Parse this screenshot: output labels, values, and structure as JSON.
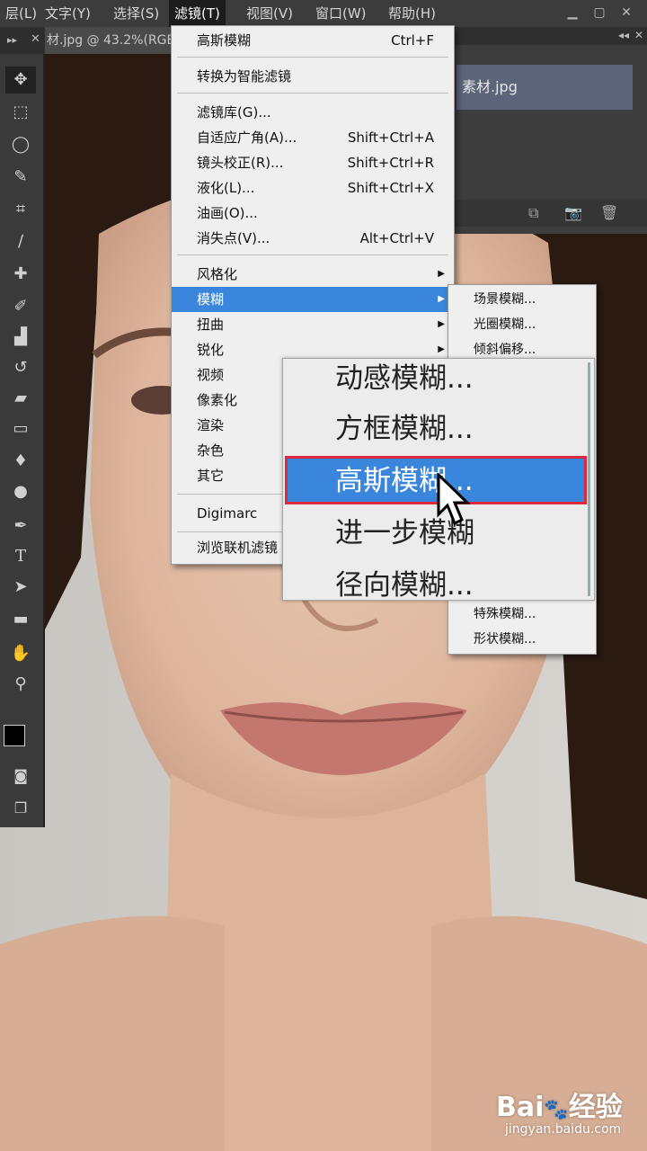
{
  "menubar": {
    "items": [
      "层(L)",
      "文字(Y)",
      "选择(S)",
      "滤镜(T)",
      "视图(V)",
      "窗口(W)",
      "帮助(H)"
    ],
    "active": "滤镜(T)"
  },
  "document_tab": {
    "title": "材.jpg @ 43.2%(RGB"
  },
  "left_strip_icons": [
    "expand-icon",
    "close-icon"
  ],
  "layers_panel": {
    "layer_name": "素材.jpg"
  },
  "filter_menu": {
    "items": [
      {
        "label": "高斯模糊",
        "shortcut": "Ctrl+F"
      },
      {
        "label": "转换为智能滤镜",
        "shortcut": ""
      },
      {
        "label": "滤镜库(G)...",
        "shortcut": ""
      },
      {
        "label": "自适应广角(A)...",
        "shortcut": "Shift+Ctrl+A"
      },
      {
        "label": "镜头校正(R)...",
        "shortcut": "Shift+Ctrl+R"
      },
      {
        "label": "液化(L)...",
        "shortcut": "Shift+Ctrl+X"
      },
      {
        "label": "油画(O)...",
        "shortcut": ""
      },
      {
        "label": "消失点(V)...",
        "shortcut": "Alt+Ctrl+V"
      },
      {
        "label": "风格化",
        "shortcut": ""
      },
      {
        "label": "模糊",
        "shortcut": ""
      },
      {
        "label": "扭曲",
        "shortcut": ""
      },
      {
        "label": "锐化",
        "shortcut": ""
      },
      {
        "label": "视频",
        "shortcut": ""
      },
      {
        "label": "像素化",
        "shortcut": ""
      },
      {
        "label": "渲染",
        "shortcut": ""
      },
      {
        "label": "杂色",
        "shortcut": ""
      },
      {
        "label": "其它",
        "shortcut": ""
      },
      {
        "label": "Digimarc",
        "shortcut": ""
      },
      {
        "label": "浏览联机滤镜",
        "shortcut": ""
      }
    ],
    "highlighted": "模糊"
  },
  "blur_submenu": {
    "items": [
      "场景模糊...",
      "光圈模糊...",
      "倾斜偏移...",
      "特殊模糊...",
      "形状模糊..."
    ]
  },
  "zoom_callout": {
    "items": [
      "动感模糊...",
      "方框模糊...",
      "高斯模糊...",
      "进一步模糊",
      "径向模糊..."
    ],
    "highlighted": "高斯模糊..."
  },
  "colors": {
    "highlight": "#3a86dd",
    "callout_border": "#e0283c",
    "menubar": "#3c3c3c"
  },
  "watermark": {
    "brand": "Bai",
    "brand2": "经验",
    "url": "jingyan.baidu.com"
  }
}
